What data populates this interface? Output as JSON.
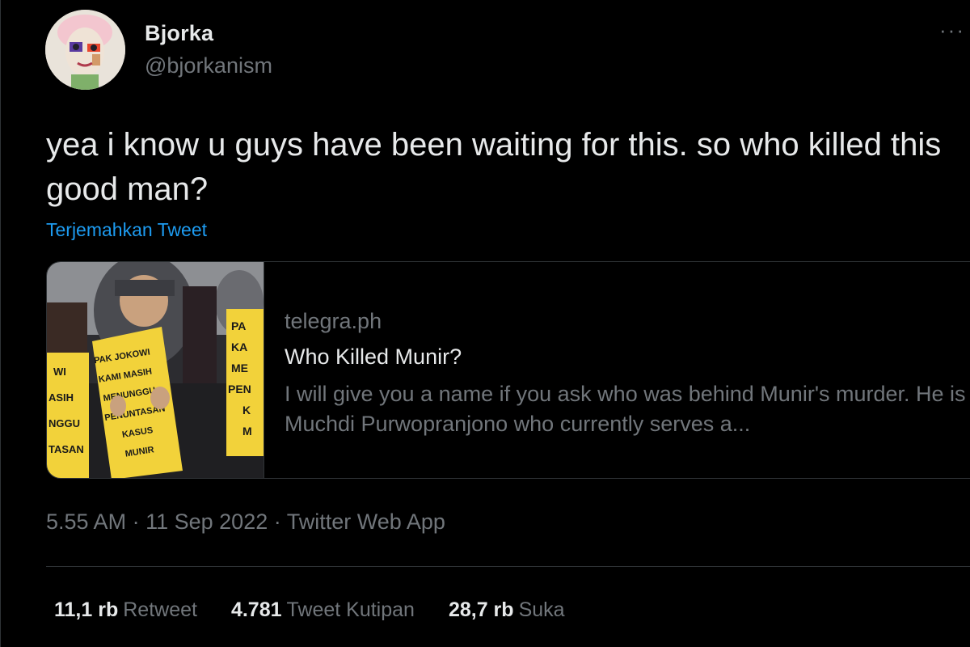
{
  "author": {
    "display_name": "Bjorka",
    "handle": "@bjorkanism"
  },
  "more_icon": "more-horizontal-icon",
  "tweet": {
    "text": "yea i know u guys have been waiting for this. so who killed this good man?",
    "translate_link": "Terjemahkan Tweet"
  },
  "card": {
    "domain": "telegra.ph",
    "title": "Who Killed Munir?",
    "description": "I will give you a name if you ask who was behind Munir's murder. He is Muchdi Purwopranjono who currently serves a...",
    "image_signs": {
      "left": [
        "WI",
        "ASIH",
        "NGGU",
        "TASAN"
      ],
      "center": [
        "PAK JOKOWI",
        "KAMI MASIH",
        "MENUNGGU",
        "PENUNTASAN",
        "KASUS",
        "MUNIR"
      ],
      "right": [
        "PA",
        "KA",
        "ME",
        "PEN",
        "K",
        "M"
      ]
    }
  },
  "meta": {
    "time": "5.55 AM",
    "date": "11 Sep 2022",
    "source": "Twitter Web App",
    "separator": "·"
  },
  "stats": [
    {
      "count": "11,1 rb",
      "label": "Retweet"
    },
    {
      "count": "4.781",
      "label": "Tweet Kutipan"
    },
    {
      "count": "28,7 rb",
      "label": "Suka"
    }
  ],
  "colors": {
    "background": "#000000",
    "text": "#e7e9ea",
    "muted": "#71767b",
    "link": "#1d9bf0",
    "border": "#2f3336",
    "sign_yellow": "#f2d23a"
  }
}
